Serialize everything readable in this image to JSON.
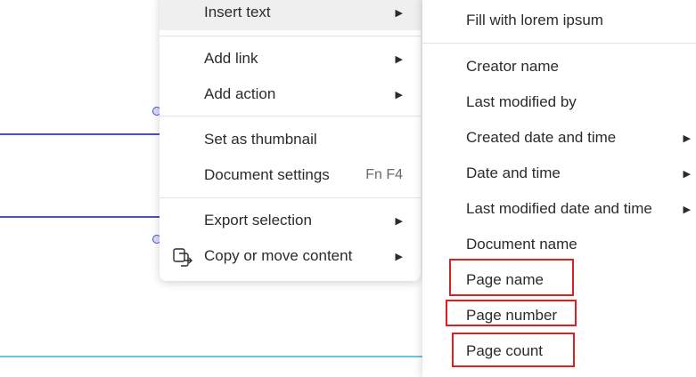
{
  "colors": {
    "connector_line": "#4b50c8",
    "bottom_line": "#6cc4d6",
    "highlight_outline": "#e02020"
  },
  "context_menu": {
    "items": [
      {
        "label": "Insert text",
        "arrow": "▶"
      },
      {
        "label": "Add link",
        "arrow": "▶"
      },
      {
        "label": "Add action",
        "arrow": "▶"
      },
      {
        "label": "Set as thumbnail"
      },
      {
        "label": "Document settings",
        "shortcut": "Fn F4"
      },
      {
        "label": "Export selection",
        "arrow": "▶"
      },
      {
        "label": "Copy or move content",
        "arrow": "▶",
        "icon": "copy-move-icon"
      }
    ]
  },
  "insert_text_submenu": {
    "items": [
      {
        "label": "Fill with lorem ipsum"
      },
      {
        "label": "Creator name"
      },
      {
        "label": "Last modified by"
      },
      {
        "label": "Created date and time",
        "arrow": "▶"
      },
      {
        "label": "Date and time",
        "arrow": "▶"
      },
      {
        "label": "Last modified date and time",
        "arrow": "▶"
      },
      {
        "label": "Document name"
      },
      {
        "label": "Page name",
        "outlined": true
      },
      {
        "label": "Page number",
        "outlined": true
      },
      {
        "label": "Page count",
        "outlined": true
      }
    ]
  }
}
